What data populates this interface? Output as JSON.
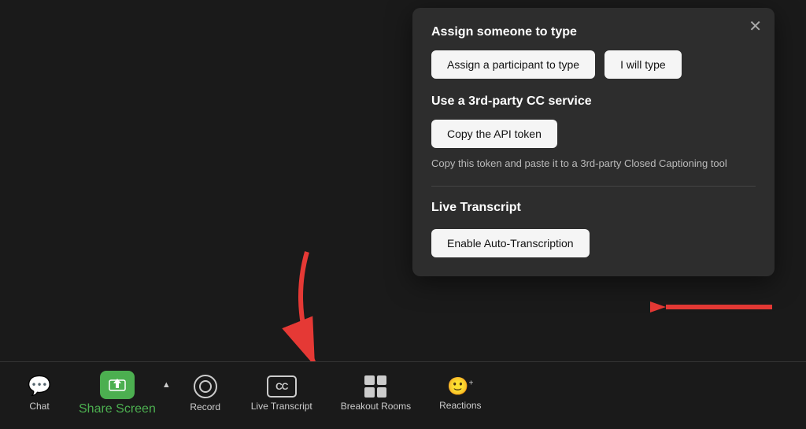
{
  "popup": {
    "close_label": "✕",
    "section1": {
      "title": "Assign someone to type",
      "btn_assign": "Assign a participant to type",
      "btn_i_will": "I will type"
    },
    "section2": {
      "title": "Use a 3rd-party CC service",
      "btn_copy": "Copy the API token",
      "helper": "Copy this token and paste it to a 3rd-party Closed Captioning tool"
    },
    "section3": {
      "title": "Live Transcript",
      "btn_enable": "Enable Auto-Transcription"
    }
  },
  "toolbar": {
    "chat": "Chat",
    "share_screen": "Share Screen",
    "record": "Record",
    "live_transcript": "Live Transcript",
    "breakout_rooms": "Breakout Rooms",
    "reactions": "Reactions",
    "cc_label": "CC"
  }
}
